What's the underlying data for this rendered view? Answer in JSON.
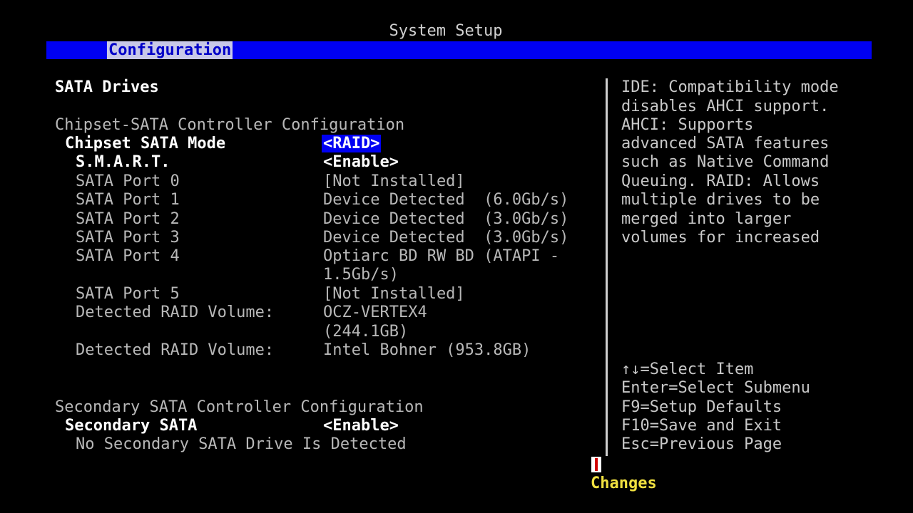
{
  "title": "System Setup",
  "menu": {
    "active_tab": "Configuration"
  },
  "section_title": "SATA Drives",
  "chipset": {
    "header": "Chipset-SATA Controller Configuration",
    "mode_label": "Chipset SATA Mode",
    "mode_value": "<RAID>",
    "smart_label": "S.M.A.R.T.",
    "smart_value": "<Enable>",
    "ports": [
      {
        "label": "SATA Port 0",
        "value": "[Not Installed]",
        "value2": ""
      },
      {
        "label": "SATA Port 1",
        "value": "Device Detected  (6.0Gb/s)",
        "value2": ""
      },
      {
        "label": "SATA Port 2",
        "value": "Device Detected  (3.0Gb/s)",
        "value2": ""
      },
      {
        "label": "SATA Port 3",
        "value": "Device Detected  (3.0Gb/s)",
        "value2": ""
      },
      {
        "label": "SATA Port 4",
        "value": "Optiarc BD RW BD (ATAPI -",
        "value2": "1.5Gb/s)"
      },
      {
        "label": "SATA Port 5",
        "value": "[Not Installed]",
        "value2": ""
      }
    ],
    "raid_volumes": [
      {
        "label": "Detected RAID Volume:",
        "value": "OCZ-VERTEX4",
        "value2": "(244.1GB)"
      },
      {
        "label": "Detected RAID Volume:",
        "value": "Intel Bohner (953.8GB)",
        "value2": ""
      }
    ]
  },
  "secondary": {
    "header": "Secondary SATA Controller Configuration",
    "label": "Secondary SATA",
    "value": "<Enable>",
    "note": "No Secondary SATA Drive Is Detected"
  },
  "help_lines": [
    "IDE: Compatibility mode",
    "disables AHCI support.",
    "AHCI: Supports",
    "advanced SATA features",
    "such as Native Command",
    "Queuing. RAID: Allows",
    "multiple drives to be",
    "merged into larger",
    "volumes for increased"
  ],
  "key_help": [
    "↑↓=Select Item",
    "Enter=Select Submenu",
    "F9=Setup Defaults",
    "F10=Save and Exit",
    "Esc=Previous Page"
  ],
  "changes_label": "Changes"
}
